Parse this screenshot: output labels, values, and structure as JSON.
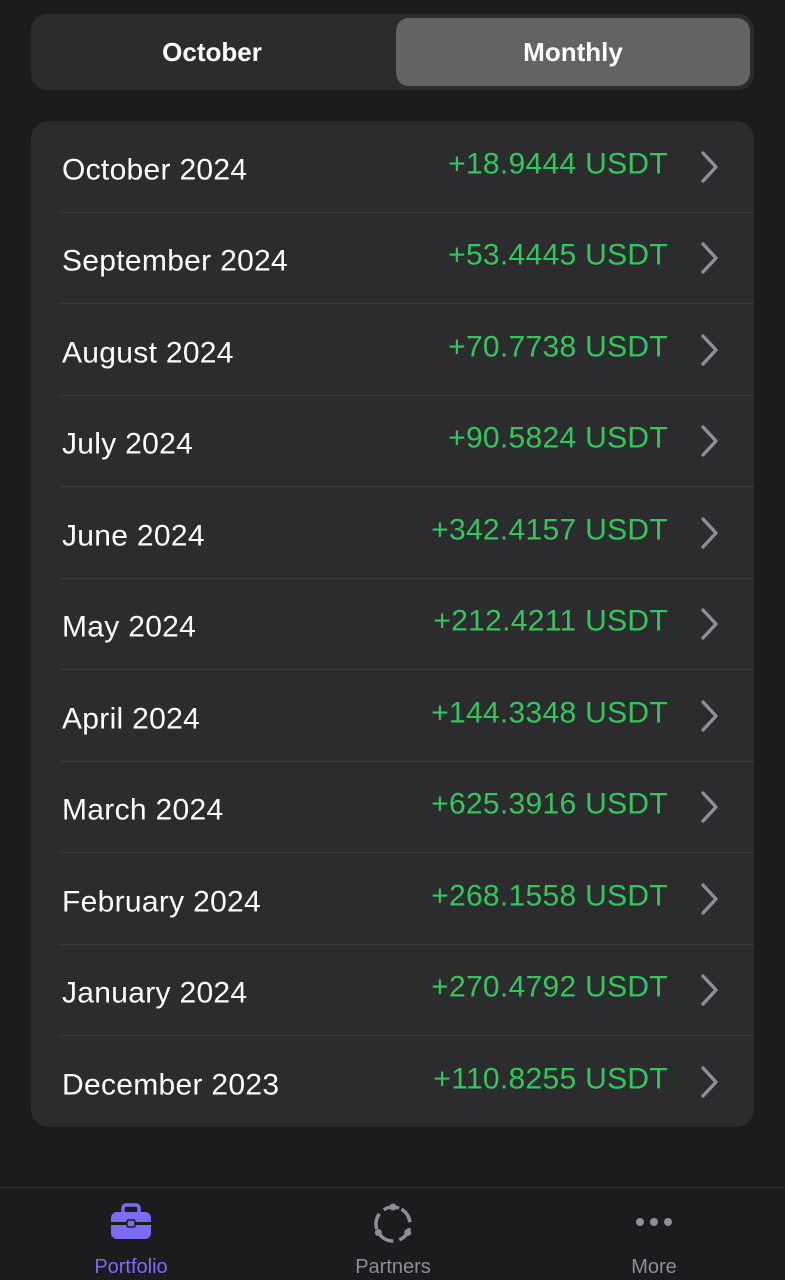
{
  "segmented": {
    "left_label": "October",
    "right_label": "Monthly",
    "selected": "Monthly"
  },
  "months": [
    {
      "label": "October 2024",
      "value": "+18.9444 USDT"
    },
    {
      "label": "September 2024",
      "value": "+53.4445 USDT"
    },
    {
      "label": "August 2024",
      "value": "+70.7738 USDT"
    },
    {
      "label": "July 2024",
      "value": "+90.5824 USDT"
    },
    {
      "label": "June 2024",
      "value": "+342.4157 USDT"
    },
    {
      "label": "May 2024",
      "value": "+212.4211 USDT"
    },
    {
      "label": "April 2024",
      "value": "+144.3348 USDT"
    },
    {
      "label": "March 2024",
      "value": "+625.3916 USDT"
    },
    {
      "label": "February 2024",
      "value": "+268.1558 USDT"
    },
    {
      "label": "January 2024",
      "value": "+270.4792 USDT"
    },
    {
      "label": "December 2023",
      "value": "+110.8255 USDT"
    }
  ],
  "tabbar": {
    "portfolio": {
      "label": "Portfolio",
      "icon": "briefcase-icon"
    },
    "partners": {
      "label": "Partners",
      "icon": "partners-circle-icon"
    },
    "more": {
      "label": "More",
      "icon": "more-dots-icon"
    }
  },
  "colors": {
    "background": "#1c1c1e",
    "card": "#2c2c2e",
    "positive": "#30c85a",
    "accent": "#7b6cf6",
    "inactive": "#8e8e93"
  }
}
